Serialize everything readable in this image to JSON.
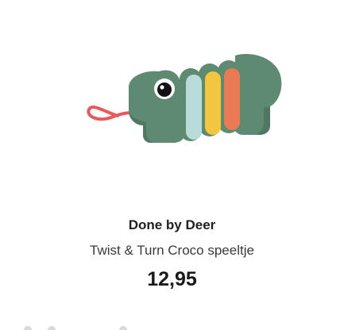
{
  "product": {
    "brand": "Done by Deer",
    "name": "Twist & Turn Croco speeltje",
    "price": "12,95",
    "image_icon": "croco-toy-image"
  },
  "colors": {
    "body_green": "#5e8a72",
    "segment_blue": "#b9dcd9",
    "segment_yellow": "#f3c63f",
    "segment_orange": "#e87b53",
    "string_red": "#e8595a"
  }
}
